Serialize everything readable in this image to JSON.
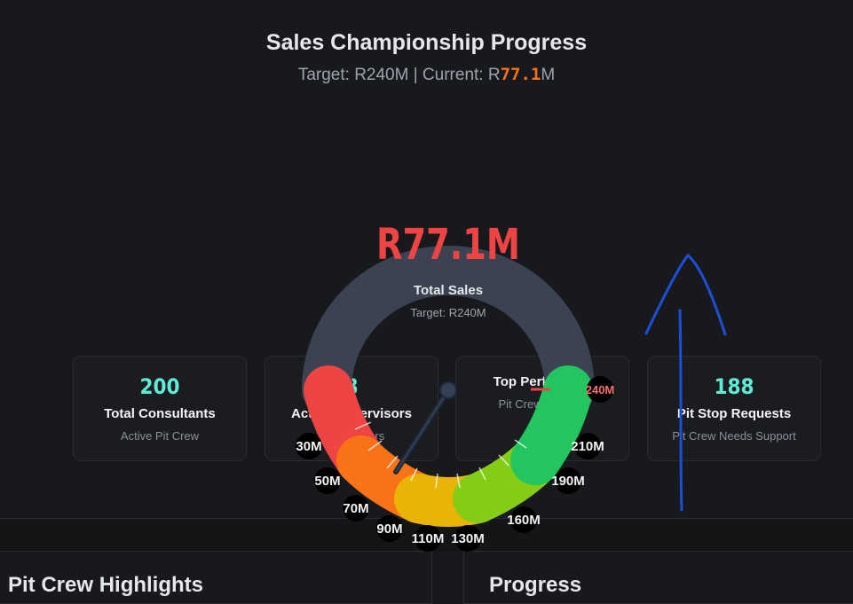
{
  "header": {
    "title": "Sales Championship Progress",
    "subtitle_prefix": "Target: R240M | Current: R",
    "current_value": "77.1",
    "subtitle_suffix": "M"
  },
  "gauge": {
    "value": "R77.1M",
    "label": "Total Sales",
    "target_label": "Target: R240M",
    "target_marker": "240M",
    "current_fraction": 0.321,
    "tick_labels": [
      "30M",
      "50M",
      "70M",
      "90M",
      "110M",
      "130M",
      "160M",
      "190M",
      "210M"
    ],
    "segment_colors": [
      "#ef4444",
      "#f97316",
      "#eab308",
      "#84cc16",
      "#22c55e"
    ],
    "track_color": "#3b4252"
  },
  "cards": [
    {
      "value": "200",
      "label": "Total Consultants",
      "sub": "Active Pit Crew"
    },
    {
      "value": "8",
      "label": "Active Supervisors",
      "sub": "Pace Drivers"
    },
    {
      "value": "",
      "label": "Top Performers",
      "sub": "Pit Crew Position"
    },
    {
      "value": "188",
      "label": "Pit Stop Requests",
      "sub": "Pit Crew Needs Support"
    }
  ],
  "panels": {
    "left_title": "Pit Crew Highlights",
    "right_title": "Progress"
  },
  "annotation": {
    "color": "#1d4ed8"
  }
}
